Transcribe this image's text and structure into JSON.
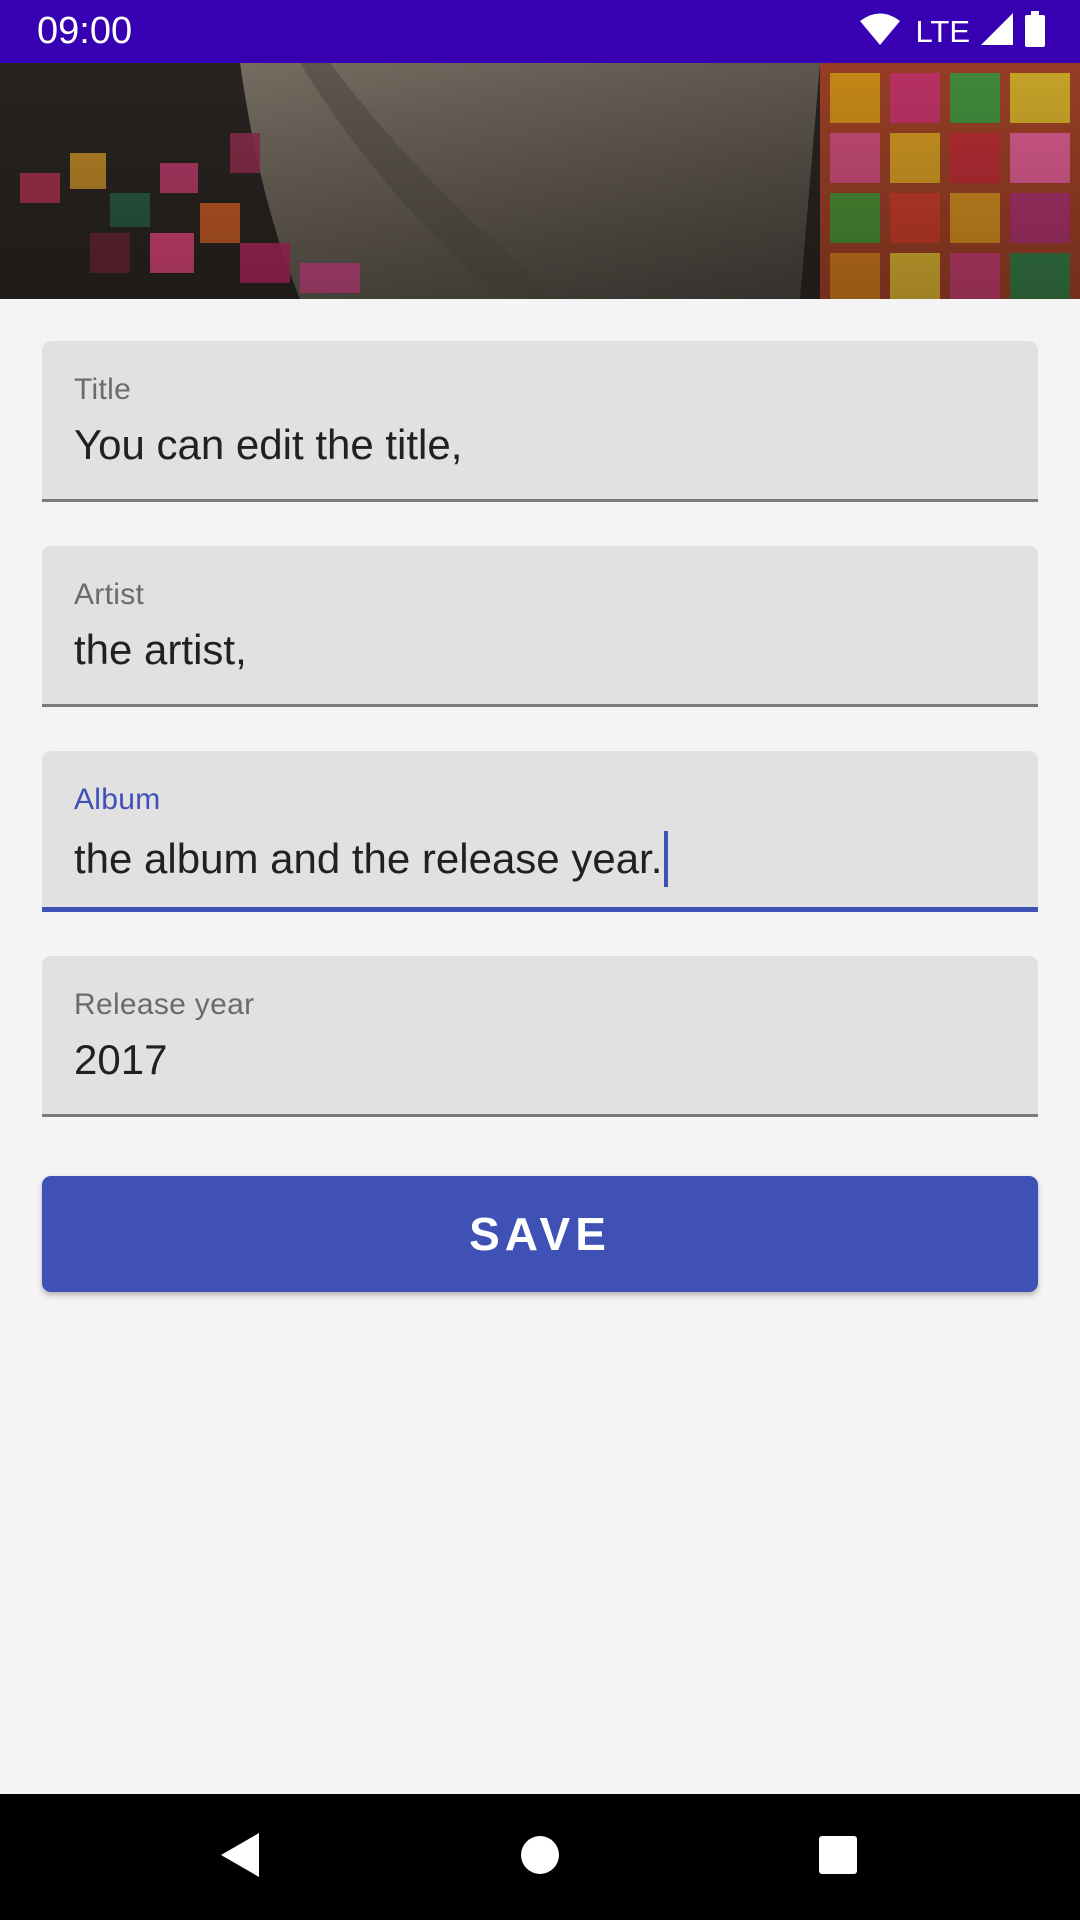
{
  "status_bar": {
    "time": "09:00",
    "network": "LTE",
    "background_color": "#3700b3"
  },
  "fields": {
    "title": {
      "label": "Title",
      "value": "You can edit the title,"
    },
    "artist": {
      "label": "Artist",
      "value": "the artist,"
    },
    "album": {
      "label": "Album",
      "value": "the album and the release year.",
      "focused": true
    },
    "release_year": {
      "label": "Release year",
      "value": "2017"
    }
  },
  "actions": {
    "save_label": "SAVE"
  },
  "colors": {
    "accent": "#3f51b5",
    "field_background": "#e1e1e1",
    "page_background": "#f4f4f4"
  },
  "icons": {
    "wifi": "wifi-icon",
    "signal": "signal-icon",
    "battery": "battery-icon",
    "back": "back-icon",
    "home": "home-icon",
    "recents": "recents-icon"
  }
}
